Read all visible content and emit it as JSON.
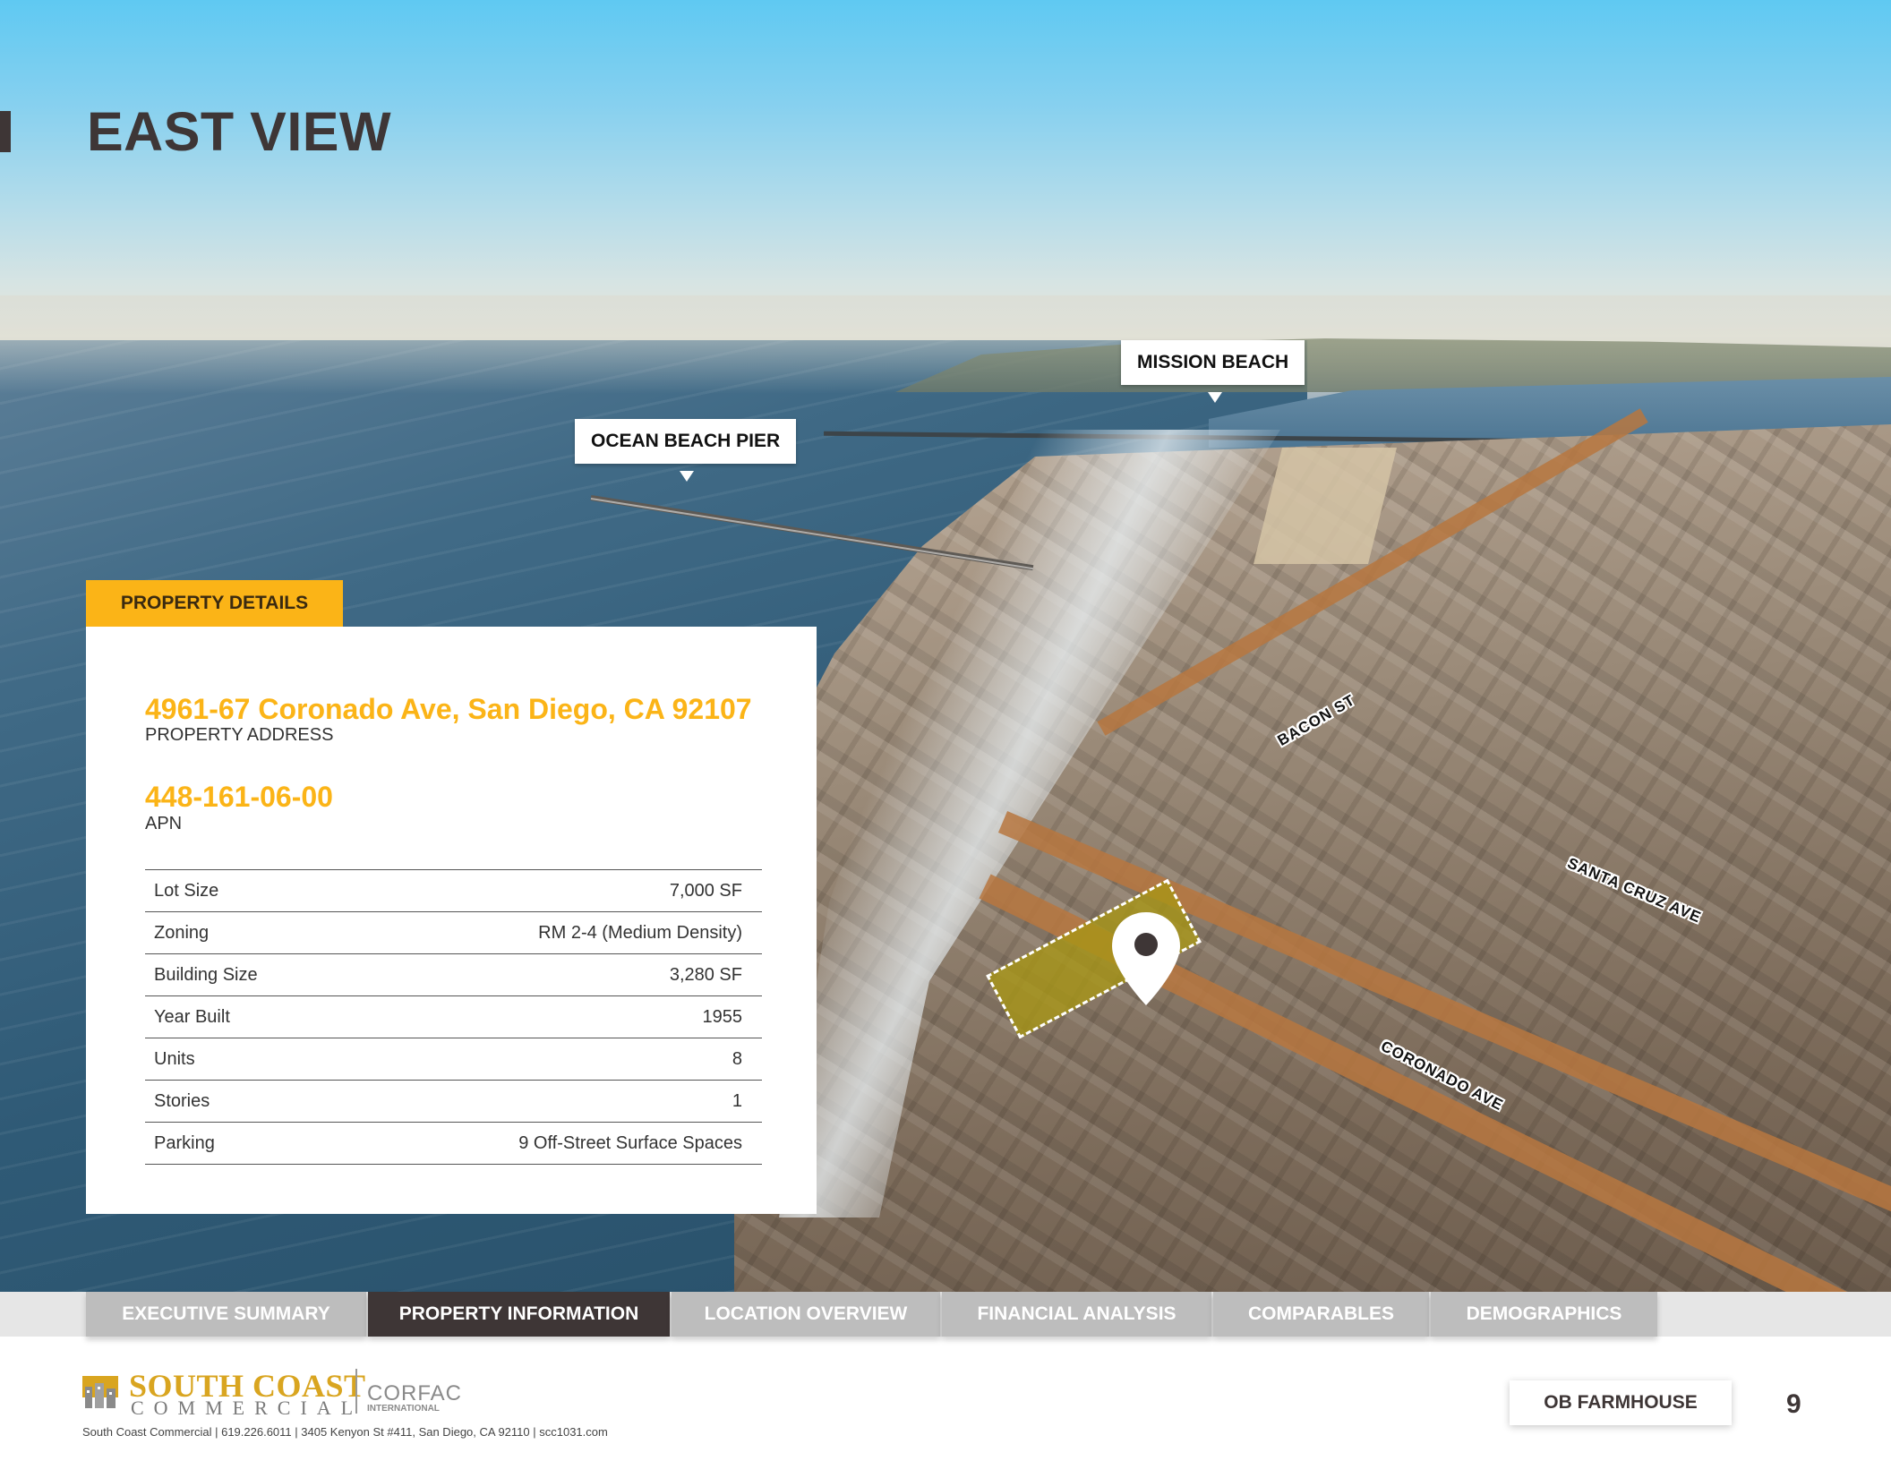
{
  "page": {
    "title": "EAST VIEW",
    "page_number": "9"
  },
  "map": {
    "callouts": {
      "mission_beach": "MISSION BEACH",
      "ocean_beach_pier": "OCEAN BEACH PIER"
    },
    "streets": {
      "bacon": "BACON ST",
      "santa_cruz": "SANTA CRUZ AVE",
      "coronado": "CORONADO AVE"
    },
    "icons": [
      "location-pin-icon"
    ]
  },
  "property_details": {
    "tab_label": "PROPERTY DETAILS",
    "address": "4961-67 Coronado Ave, San Diego, CA 92107",
    "address_label": "PROPERTY ADDRESS",
    "apn": "448-161-06-00",
    "apn_label": "APN",
    "specs": [
      {
        "label": "Lot Size",
        "value": "7,000 SF"
      },
      {
        "label": "Zoning",
        "value": "RM 2-4 (Medium Density)"
      },
      {
        "label": "Building Size",
        "value": "3,280 SF"
      },
      {
        "label": "Year Built",
        "value": "1955"
      },
      {
        "label": "Units",
        "value": "8"
      },
      {
        "label": "Stories",
        "value": "1"
      },
      {
        "label": "Parking",
        "value": "9 Off-Street Surface Spaces"
      }
    ]
  },
  "nav": {
    "tabs": [
      {
        "label": "EXECUTIVE SUMMARY",
        "active": false
      },
      {
        "label": "PROPERTY INFORMATION",
        "active": true
      },
      {
        "label": "LOCATION OVERVIEW",
        "active": false
      },
      {
        "label": "FINANCIAL ANALYSIS",
        "active": false
      },
      {
        "label": "COMPARABLES",
        "active": false
      },
      {
        "label": "DEMOGRAPHICS",
        "active": false
      }
    ]
  },
  "footer": {
    "logo_primary": "SOUTH COAST",
    "logo_secondary": "COMMERCIAL",
    "partner_logo": "CORFAC",
    "partner_logo_sub": "INTERNATIONAL",
    "contact": "South Coast Commercial | 619.226.6011 | 3405 Kenyon St #411, San Diego, CA 92110 | scc1031.com",
    "property_name": "OB FARMHOUSE"
  },
  "colors": {
    "accent": "#fbb417",
    "dark": "#3e3636",
    "tab_inactive": "#bdbdbd"
  }
}
